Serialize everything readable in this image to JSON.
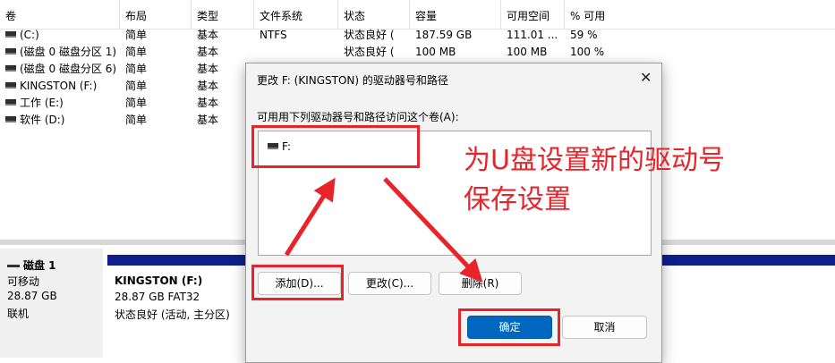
{
  "volume_list": {
    "columns": [
      "卷",
      "布局",
      "类型",
      "文件系统",
      "状态",
      "容量",
      "可用空间",
      "% 可用"
    ],
    "rows": [
      {
        "volume": "(C:)",
        "layout": "简单",
        "type": "基本",
        "fs": "NTFS",
        "status": "状态良好 (",
        "capacity": "187.59 GB",
        "free": "111.01 ...",
        "pct": "59 %"
      },
      {
        "volume": "(磁盘 0 磁盘分区 1)",
        "layout": "简单",
        "type": "基本",
        "fs": "",
        "status": "状态良好 (",
        "capacity": "100 MB",
        "free": "100 MB",
        "pct": "100 %"
      },
      {
        "volume": "(磁盘 0 磁盘分区 6)",
        "layout": "简单",
        "type": "基本",
        "fs": "",
        "status": "",
        "capacity": "",
        "free": "",
        "pct": ""
      },
      {
        "volume": "KINGSTON (F:)",
        "layout": "简单",
        "type": "基本",
        "fs": "",
        "status": "",
        "capacity": "",
        "free": "",
        "pct": ""
      },
      {
        "volume": "工作 (E:)",
        "layout": "简单",
        "type": "基本",
        "fs": "",
        "status": "",
        "capacity": "",
        "free": "",
        "pct": ""
      },
      {
        "volume": "软件 (D:)",
        "layout": "简单",
        "type": "基本",
        "fs": "",
        "status": "",
        "capacity": "",
        "free": "",
        "pct": ""
      }
    ]
  },
  "disk_map": {
    "disk_name": "磁盘 1",
    "disk_type": "可移动",
    "disk_size": "28.87 GB",
    "disk_status": "联机",
    "partition_name": "KINGSTON (F:)",
    "partition_size": "28.87 GB FAT32",
    "partition_status": "状态良好 (活动, 主分区)",
    "partition_bar_color": "#0e1f8c"
  },
  "dialog": {
    "title": "更改 F: (KINGSTON) 的驱动器号和路径",
    "close_icon": "close-icon",
    "prompt": "可用用下列驱动器号和路径访问这个卷(A):",
    "list_items": [
      "F:"
    ],
    "buttons": {
      "add": "添加(D)...",
      "change": "更改(C)...",
      "remove": "删除(R)",
      "ok": "确定",
      "cancel": "取消"
    },
    "accent_color": "#0067c0"
  },
  "annotation": {
    "line1": "为U盘设置新的驱动号",
    "line2": "保存设置",
    "color": "#e8232a"
  }
}
